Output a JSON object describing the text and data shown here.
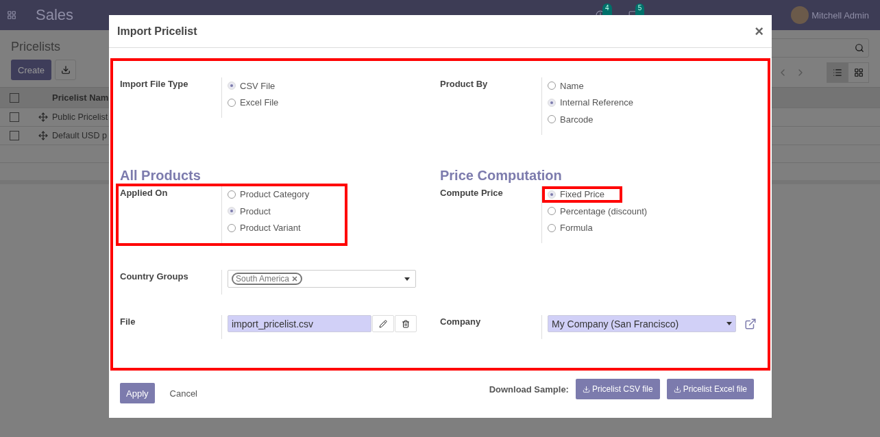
{
  "navbar": {
    "app_name": "Sales",
    "activity_count": "4",
    "message_count": "5",
    "user": "Mitchell Admin"
  },
  "page": {
    "title": "Pricelists",
    "create_button": "Create",
    "table": {
      "header_checked": false,
      "columns": [
        "Pricelist Nam"
      ],
      "rows": [
        {
          "name": "Public Pricelist",
          "checked": false
        },
        {
          "name": "Default USD p",
          "checked": false
        }
      ]
    }
  },
  "dialog": {
    "title": "Import Pricelist",
    "close": "×",
    "highlighted": true,
    "import_file_type": {
      "label": "Import File Type",
      "highlighted": false,
      "options": [
        {
          "label": "CSV File",
          "selected": true,
          "highlighted": false
        },
        {
          "label": "Excel File",
          "selected": false,
          "highlighted": false
        }
      ]
    },
    "product_by": {
      "label": "Product By",
      "highlighted": false,
      "options": [
        {
          "label": "Name",
          "selected": false,
          "highlighted": false
        },
        {
          "label": "Internal Reference",
          "selected": true,
          "highlighted": false
        },
        {
          "label": "Barcode",
          "selected": false,
          "highlighted": false
        }
      ]
    },
    "all_products_heading": "All Products",
    "price_computation_heading": "Price Computation",
    "applied_on": {
      "label": "Applied On",
      "highlighted": true,
      "options": [
        {
          "label": "Product Category",
          "selected": false,
          "highlighted": false
        },
        {
          "label": "Product",
          "selected": true,
          "highlighted": false
        },
        {
          "label": "Product Variant",
          "selected": false,
          "highlighted": false
        }
      ]
    },
    "compute_price": {
      "label": "Compute Price",
      "highlighted": false,
      "options": [
        {
          "label": "Fixed Price",
          "selected": true,
          "highlighted": true
        },
        {
          "label": "Percentage (discount)",
          "selected": false,
          "highlighted": false
        },
        {
          "label": "Formula",
          "selected": false,
          "highlighted": false
        }
      ]
    },
    "country_groups": {
      "label": "Country Groups",
      "tags": [
        "South America"
      ]
    },
    "file": {
      "label": "File",
      "value": "import_pricelist.csv"
    },
    "company": {
      "label": "Company",
      "value": "My Company (San Francisco)"
    },
    "footer": {
      "apply": "Apply",
      "cancel": "Cancel",
      "download_label": "Download Sample:",
      "downloads": [
        "Pricelist CSV file",
        "Pricelist Excel file"
      ]
    }
  }
}
